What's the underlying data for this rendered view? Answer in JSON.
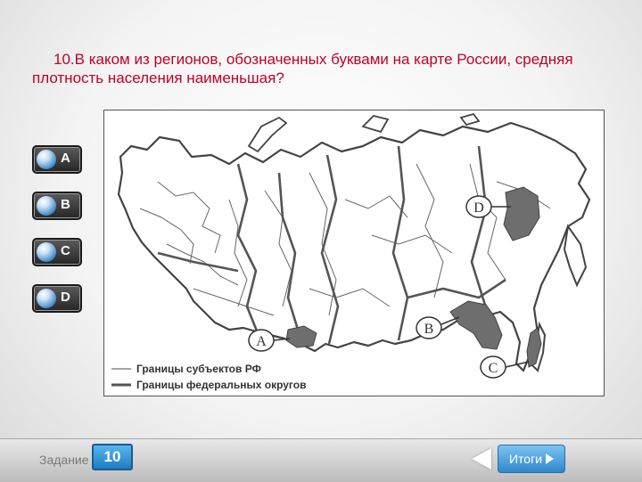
{
  "question": {
    "text": "10.В каком из регионов, обозначенных буквами на карте России, средняя плотность населения наименьшая?"
  },
  "options": [
    {
      "label": "A"
    },
    {
      "label": "B"
    },
    {
      "label": "C"
    },
    {
      "label": "D"
    }
  ],
  "map": {
    "region_labels": [
      "A",
      "B",
      "C",
      "D"
    ],
    "legend": {
      "subjects": "Границы субъектов РФ",
      "districts": "Границы федеральных округов"
    }
  },
  "footer": {
    "task_label": "Задание",
    "task_number": "10",
    "results_label": "Итоги"
  }
}
